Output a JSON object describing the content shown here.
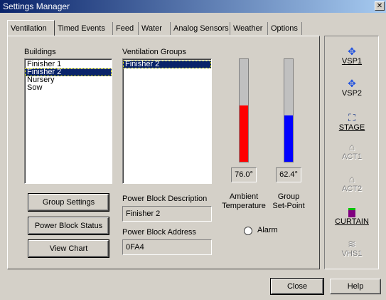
{
  "window": {
    "title": "Settings Manager",
    "close_glyph": "✕"
  },
  "tabs": [
    "Ventilation",
    "Timed Events",
    "Feed",
    "Water",
    "Analog Sensors",
    "Weather",
    "Options"
  ],
  "buildings": {
    "label": "Buildings",
    "items": [
      "Finisher 1",
      "Finisher 2",
      "Nursery",
      "Sow"
    ],
    "selected": "Finisher 2"
  },
  "groups": {
    "label": "Ventilation Groups",
    "items": [
      "Finisher 2"
    ],
    "selected": "Finisher 2"
  },
  "buttons": {
    "group_settings": "Group Settings",
    "power_block_status": "Power Block Status",
    "view_chart": "View Chart",
    "close": "Close",
    "help": "Help"
  },
  "power_block": {
    "description_label": "Power Block Description",
    "description_value": "Finisher 2",
    "address_label": "Power Block Address",
    "address_value": "0FA4"
  },
  "gauges": {
    "ambient": {
      "value": "76.0°",
      "label_line1": "Ambient",
      "label_line2": "Temperature",
      "fill_fraction": 0.55,
      "color": "#ff0000"
    },
    "setpoint": {
      "value": "62.4°",
      "label_line1": "Group",
      "label_line2": "Set-Point",
      "fill_fraction": 0.45,
      "color": "#0000ff"
    }
  },
  "alarm": {
    "label": "Alarm",
    "checked": false
  },
  "devices": [
    {
      "label": "VSP1",
      "icon": "fan-icon",
      "enabled": true
    },
    {
      "label": "VSP2",
      "icon": "fan-icon",
      "enabled": true
    },
    {
      "label": "STAGE",
      "icon": "stage-icon",
      "enabled": true
    },
    {
      "label": "ACT1",
      "icon": "actuator-icon",
      "enabled": false
    },
    {
      "label": "ACT2",
      "icon": "actuator-icon",
      "enabled": false
    },
    {
      "label": "CURTAIN",
      "icon": "curtain-icon",
      "enabled": true
    },
    {
      "label": "VHS1",
      "icon": "heater-icon",
      "enabled": false
    }
  ],
  "colors": {
    "selection": "#0a246a",
    "face": "#d4d0c8"
  }
}
